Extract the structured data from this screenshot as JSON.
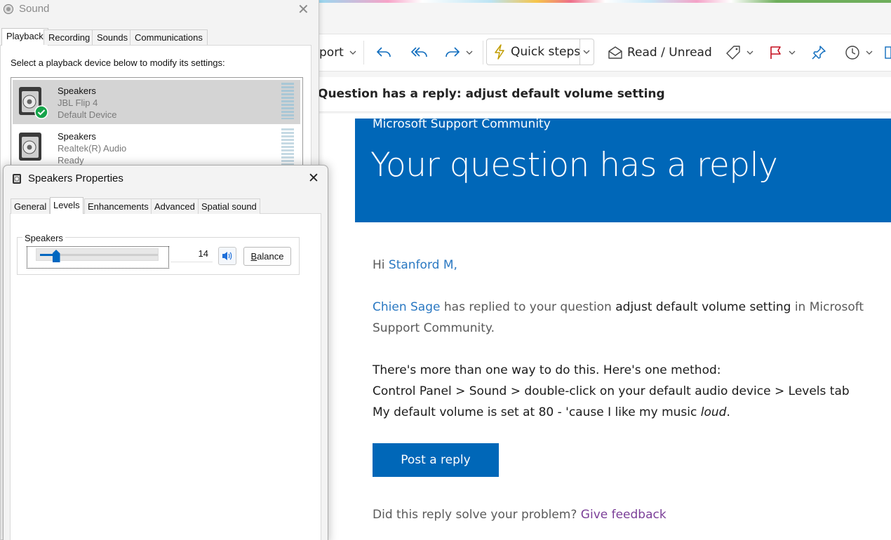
{
  "outlook": {
    "ribbon": {
      "report_partial": "port",
      "quick_steps": "Quick steps",
      "read_unread": "Read / Unread"
    },
    "subject": "Question has a reply: adjust default volume setting",
    "email": {
      "brand": "Microsoft Support Community",
      "headline": "Your question has a reply",
      "greeting_prefix": "Hi ",
      "recipient": "Stanford M,",
      "replier": "Chien Sage",
      "replied_text": " has replied to your question ",
      "question_title": "adjust default volume setting",
      "replied_suffix": " in Microsoft",
      "replied_line2": "Support Community.",
      "body_line1": "There's more than one way to do this. Here's one method:",
      "body_line2": "Control Panel > Sound > double-click on your default audio device > Levels tab",
      "body_line3_prefix": "My default volume is set at 80 - 'cause I like my music ",
      "body_line3_emph": "loud",
      "body_line3_suffix": ".",
      "post_reply": "Post a reply",
      "feedback_question": "Did this reply solve your problem? ",
      "feedback_link": "Give feedback"
    }
  },
  "sound_dialog": {
    "title": "Sound",
    "tabs": [
      "Playback",
      "Recording",
      "Sounds",
      "Communications"
    ],
    "active_tab": "Playback",
    "instruction": "Select a playback device below to modify its settings:",
    "devices": [
      {
        "name": "Speakers",
        "description": "JBL Flip 4",
        "status": "Default Device",
        "selected": true
      },
      {
        "name": "Speakers",
        "description": "Realtek(R) Audio",
        "status": "Ready",
        "selected": false
      }
    ]
  },
  "properties_dialog": {
    "title": "Speakers Properties",
    "tabs": [
      "General",
      "Levels",
      "Enhancements",
      "Advanced",
      "Spatial sound"
    ],
    "active_tab": "Levels",
    "level_group_label": "Speakers",
    "level_value": "14",
    "level_fraction": 0.14,
    "balance_button": "Balance"
  },
  "colors": {
    "ms_blue": "#0067b8",
    "link_blue": "#2a78c2",
    "visited_purple": "#7b3f98",
    "slider_blue": "#0067c0"
  }
}
